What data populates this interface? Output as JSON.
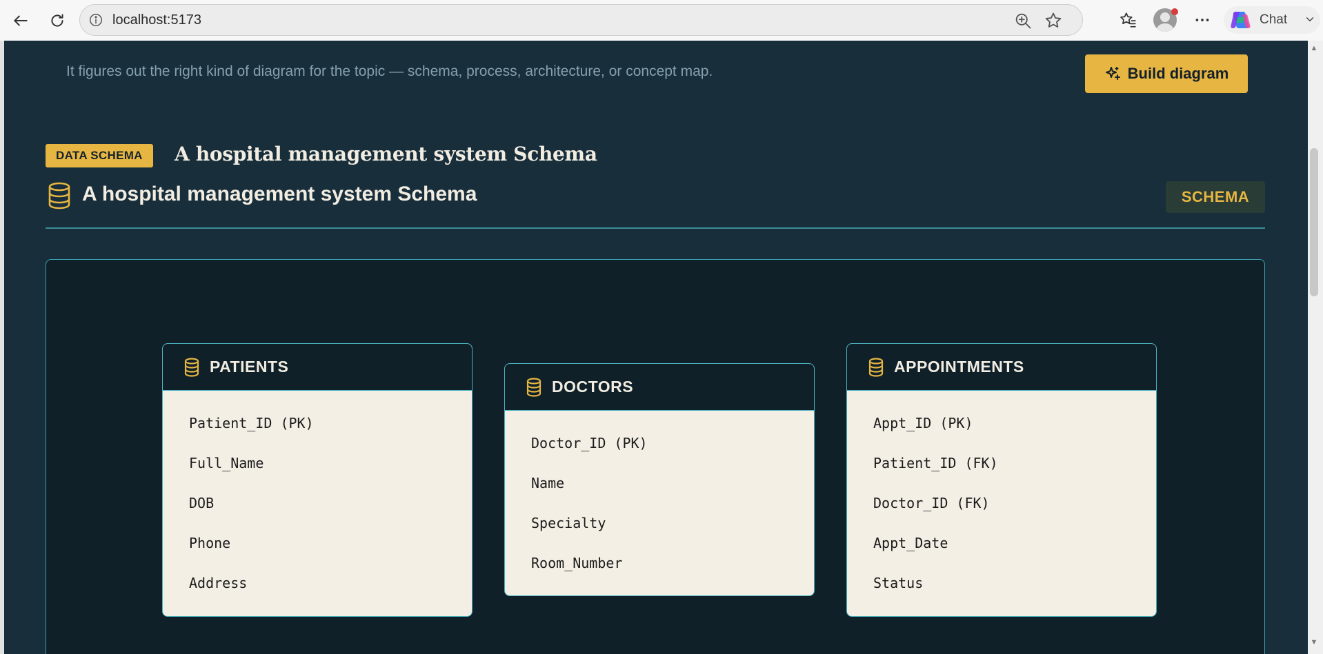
{
  "browser": {
    "url": "localhost:5173",
    "chat_label": "Chat"
  },
  "header": {
    "helper_text": "It figures out the right kind of diagram for the topic — schema, process, architecture, or concept map.",
    "build_button_label": "Build diagram"
  },
  "result": {
    "badge": "DATA SCHEMA",
    "title": "A hospital management system Schema",
    "schema_title": "A hospital management system Schema",
    "type_chip": "SCHEMA"
  },
  "colors": {
    "accent": "#e7b642",
    "page_bg": "#182e3b",
    "canvas_bg": "#0f2029",
    "card_bg": "#f4efe5",
    "border": "#4cb3c2"
  },
  "tables": [
    {
      "name": "PATIENTS",
      "icon": "database-icon",
      "fields": [
        "Patient_ID (PK)",
        "Full_Name",
        "DOB",
        "Phone",
        "Address"
      ]
    },
    {
      "name": "DOCTORS",
      "icon": "database-icon",
      "fields": [
        "Doctor_ID (PK)",
        "Name",
        "Specialty",
        "Room_Number"
      ]
    },
    {
      "name": "APPOINTMENTS",
      "icon": "database-icon",
      "fields": [
        "Appt_ID (PK)",
        "Patient_ID (FK)",
        "Doctor_ID (FK)",
        "Appt_Date",
        "Status"
      ]
    }
  ]
}
